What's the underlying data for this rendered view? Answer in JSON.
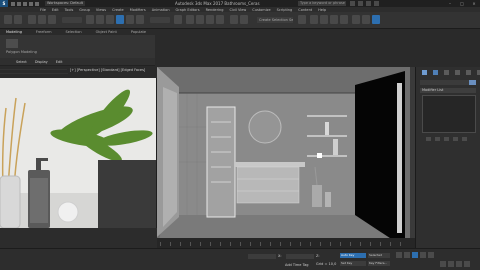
{
  "window": {
    "title": "Autodesk 3ds Max 2017    Bathrooms_Ceras",
    "workspace": "Workspaces: Default",
    "search_placeholder": "Type a keyword or phrase",
    "controls": [
      "–",
      "□",
      "×"
    ]
  },
  "menu": [
    "File",
    "Edit",
    "Tools",
    "Group",
    "Views",
    "Create",
    "Modifiers",
    "Animation",
    "Graph Editors",
    "Rendering",
    "Civil View",
    "Customize",
    "Scripting",
    "Content",
    "Help"
  ],
  "toolbar": {
    "selection_set": "Create Selection Set"
  },
  "ribbon": {
    "tabs": [
      "Modeling",
      "Freeform",
      "Selection",
      "Object Paint",
      "Populate"
    ],
    "panel_label": "Polygon Modeling"
  },
  "scene_explorer": {
    "tabs": [
      "Select",
      "Display",
      "Edit"
    ]
  },
  "viewport": {
    "label": "[+] [Perspective] [Standard] [Edged Faces]"
  },
  "command_panel": {
    "modifier_list": "Modifier List",
    "accent_color": "#6a8fbf"
  },
  "status": {
    "x_label": "X:",
    "y_label": "Y:",
    "z_label": "Z:",
    "grid": "Grid = 10,0",
    "auto_key": "Auto Key",
    "set_key": "Set Key",
    "selected": "Selected",
    "key_filters": "Key Filters...",
    "add_time_tag": "Add Time Tag"
  },
  "colors": {
    "viewport_bg": "#6d6d6d",
    "selection_blue": "#2d6fb0",
    "dark_wall": "#050505"
  }
}
